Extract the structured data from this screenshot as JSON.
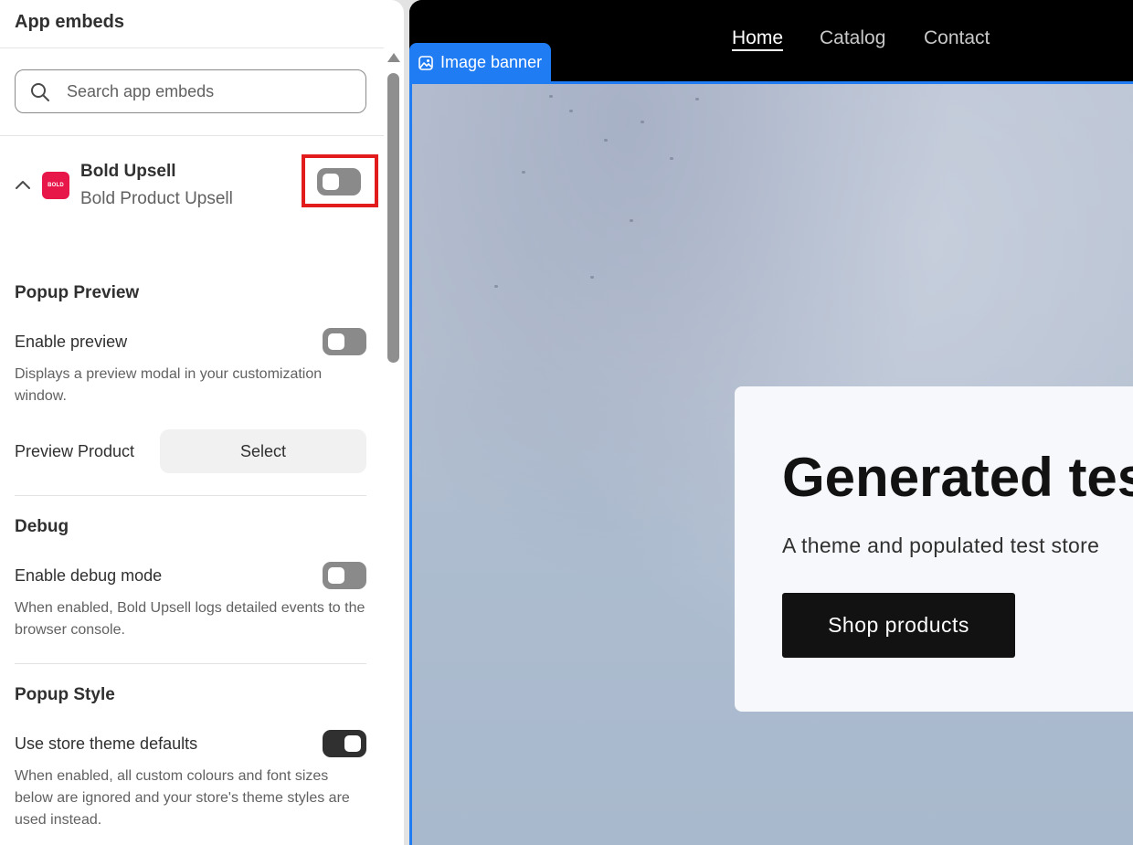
{
  "panel": {
    "title": "App embeds",
    "search": {
      "placeholder": "Search app embeds",
      "value": ""
    },
    "app": {
      "name": "Bold Upsell",
      "subtitle": "Bold Product Upsell",
      "logo_text": "BOLD",
      "logo_color": "#e8174a",
      "enabled": false
    },
    "sections": {
      "popup_preview": {
        "title": "Popup Preview",
        "enable_label": "Enable preview",
        "enable_on": false,
        "help": "Displays a preview modal in your customization window.",
        "product_label": "Preview Product",
        "select_label": "Select"
      },
      "debug": {
        "title": "Debug",
        "enable_label": "Enable debug mode",
        "enable_on": false,
        "help": "When enabled, Bold Upsell logs detailed events to the browser console."
      },
      "popup_style": {
        "title": "Popup Style",
        "defaults_label": "Use store theme defaults",
        "defaults_on": true,
        "help": "When enabled, all custom colours and font sizes below are ignored and your store's theme styles are used instead."
      }
    }
  },
  "preview": {
    "nav": {
      "home": "Home",
      "catalog": "Catalog",
      "contact": "Contact"
    },
    "banner_tag": "Image banner",
    "accent_color": "#1f7cf3",
    "hero": {
      "title": "Generated tes",
      "subtitle": "A theme and populated test store",
      "button": "Shop products"
    }
  }
}
